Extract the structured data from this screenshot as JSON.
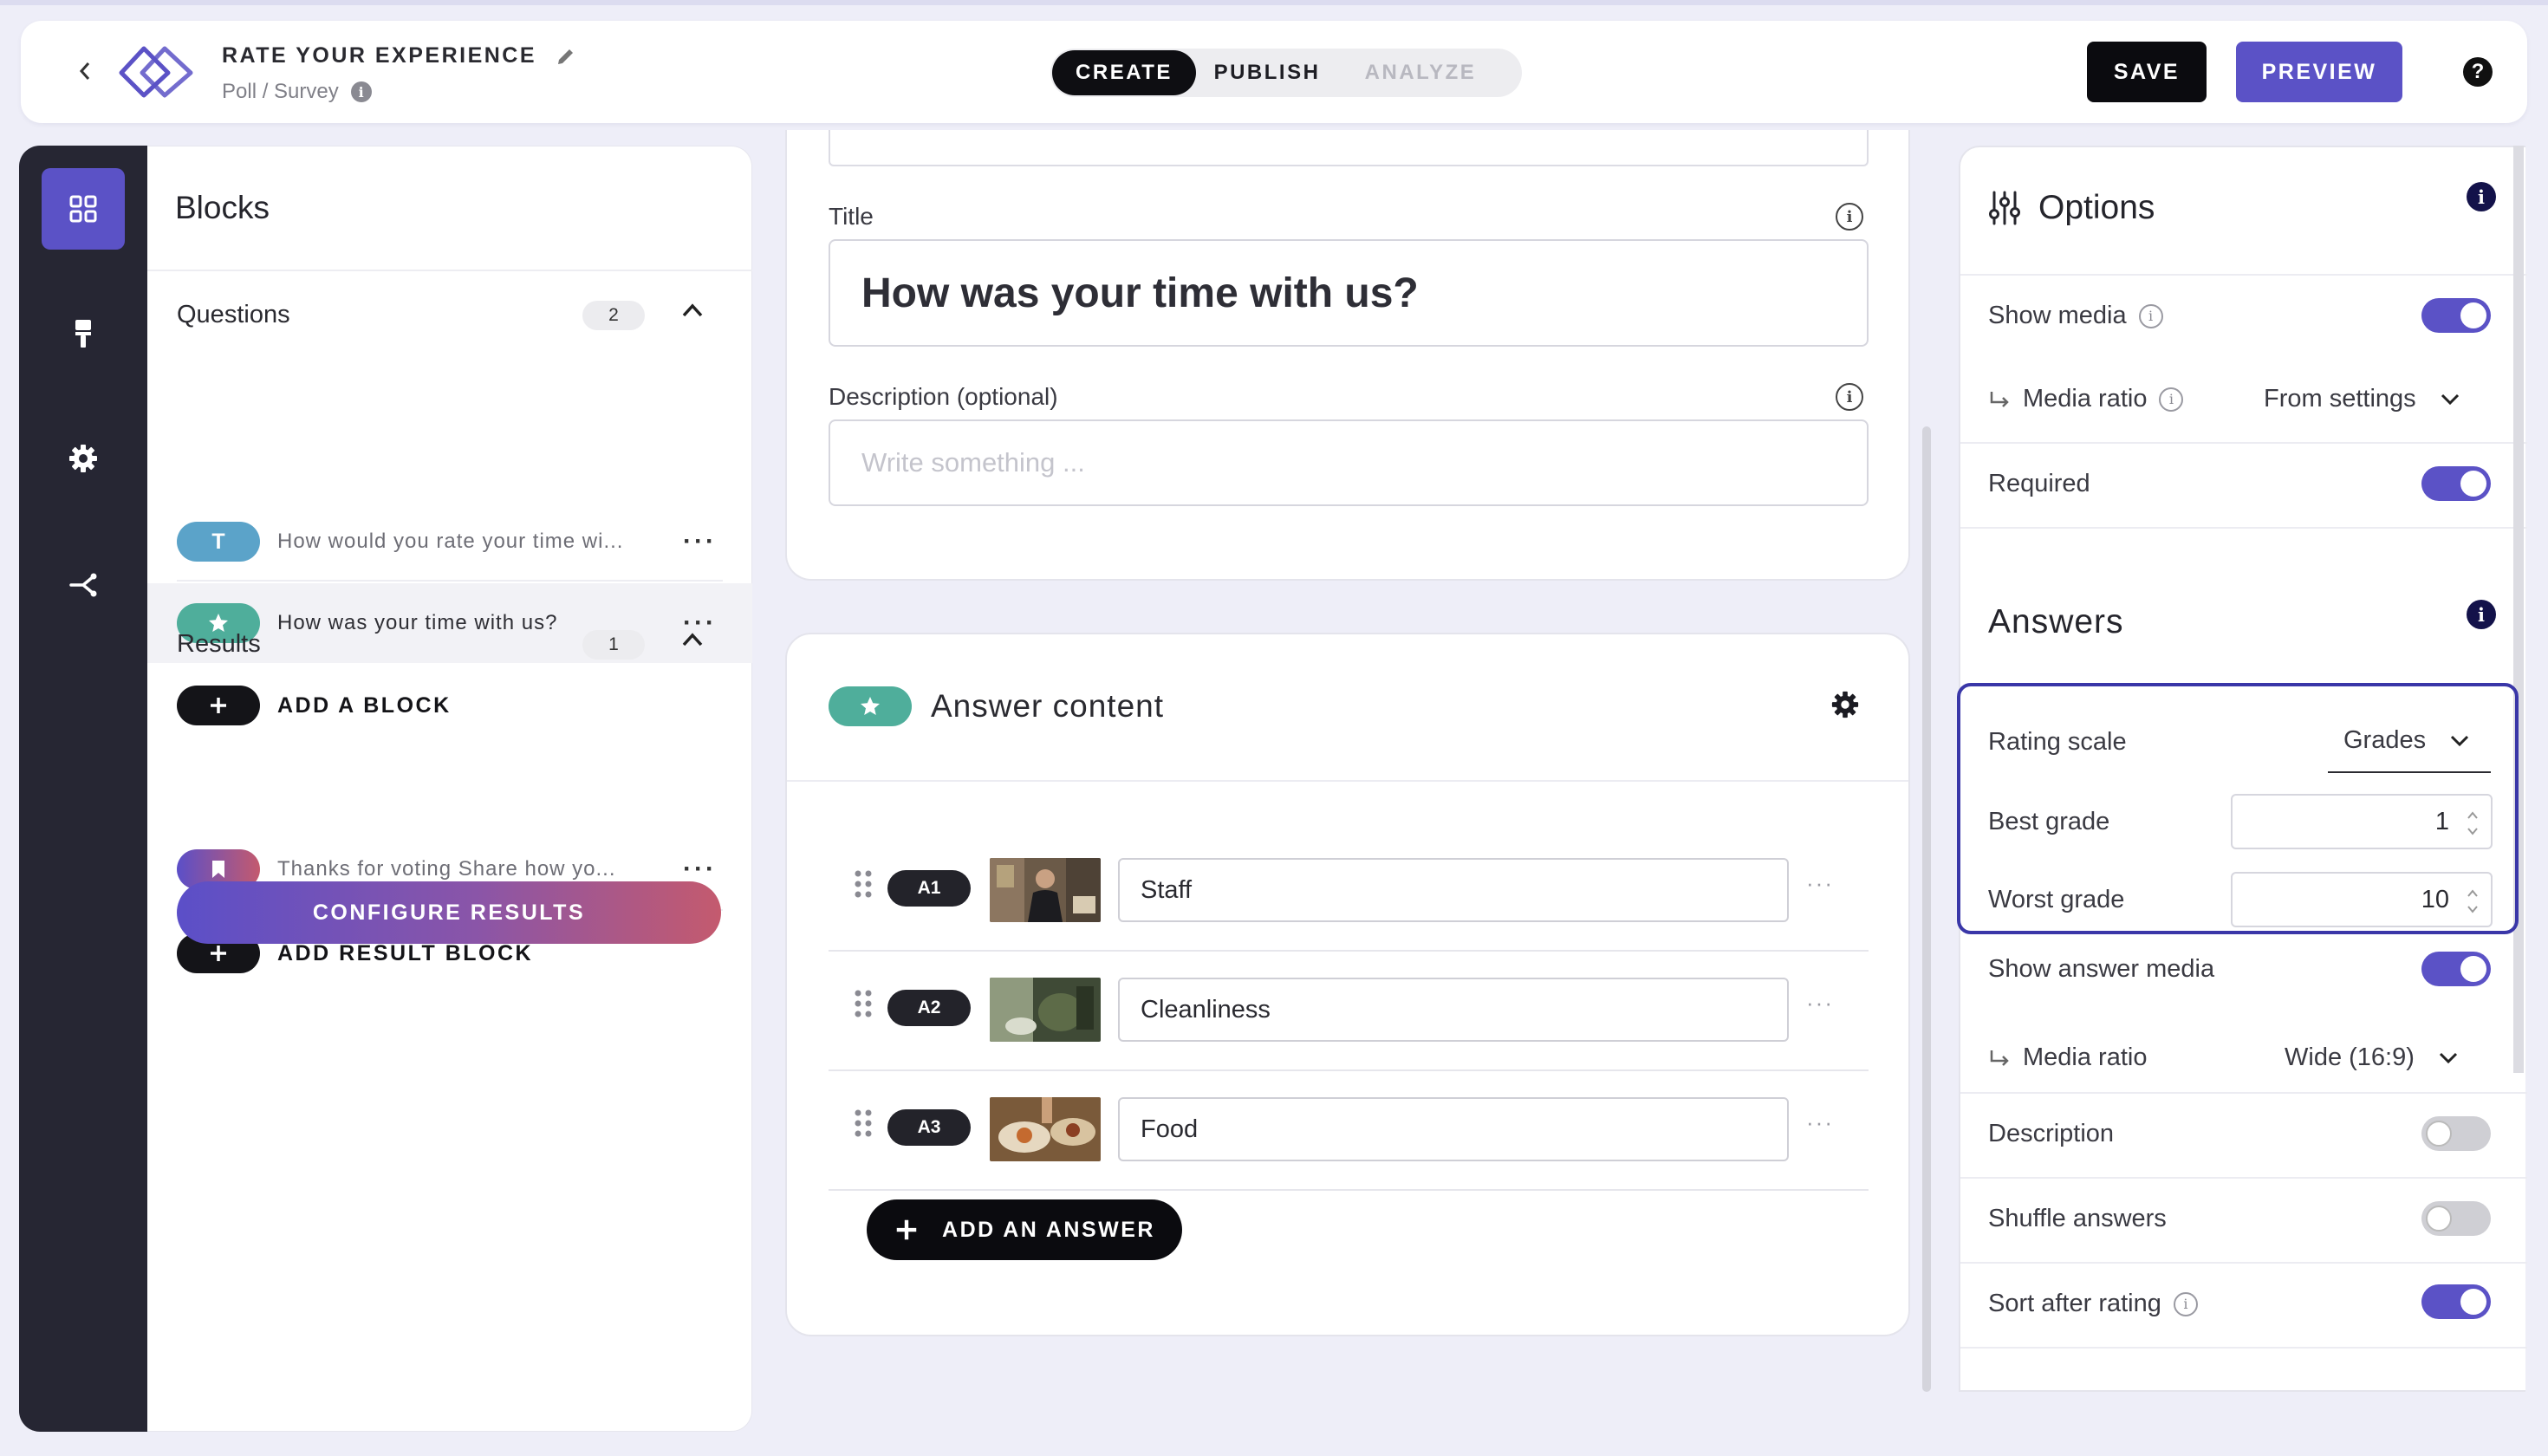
{
  "header": {
    "title": "RATE YOUR EXPERIENCE",
    "subtitle": "Poll / Survey",
    "modes": [
      "CREATE",
      "PUBLISH",
      "ANALYZE"
    ],
    "save_label": "SAVE",
    "preview_label": "PREVIEW",
    "help_label": "?"
  },
  "blocks": {
    "title": "Blocks",
    "questions": {
      "label": "Questions",
      "count": "2",
      "items": [
        {
          "badge": "T",
          "text": "How would you rate your time wi...",
          "color": "#5ba3c9"
        },
        {
          "badge": "star-icon",
          "text": "How was your time with us?",
          "color": "#4fae9b"
        }
      ],
      "add_label": "ADD A BLOCK"
    },
    "results": {
      "label": "Results",
      "count": "1",
      "items": [
        {
          "badge": "bookmark-icon",
          "text": "Thanks for voting Share how yo..."
        }
      ],
      "add_label": "ADD RESULT BLOCK"
    },
    "configure_label": "CONFIGURE RESULTS"
  },
  "editor": {
    "title_label": "Title",
    "title_value": "How was your time with us?",
    "description_label": "Description (optional)",
    "description_placeholder": "Write something ..."
  },
  "answer_content": {
    "title": "Answer content",
    "answers": [
      {
        "id": "A1",
        "value": "Staff"
      },
      {
        "id": "A2",
        "value": "Cleanliness"
      },
      {
        "id": "A3",
        "value": "Food"
      }
    ],
    "add_label": "ADD AN ANSWER"
  },
  "options": {
    "title": "Options",
    "show_media": {
      "label": "Show media",
      "on": true
    },
    "media_ratio": {
      "label": "Media ratio",
      "value": "From settings"
    },
    "required": {
      "label": "Required",
      "on": true
    },
    "answers_title": "Answers",
    "rating_scale": {
      "label": "Rating scale",
      "value": "Grades"
    },
    "best_grade": {
      "label": "Best grade",
      "value": "1"
    },
    "worst_grade": {
      "label": "Worst grade",
      "value": "10"
    },
    "show_answer_media": {
      "label": "Show answer media",
      "on": true
    },
    "answer_media_ratio": {
      "label": "Media ratio",
      "value": "Wide (16:9)"
    },
    "description": {
      "label": "Description",
      "on": false
    },
    "shuffle_answers": {
      "label": "Shuffle answers",
      "on": false
    },
    "sort_after_rating": {
      "label": "Sort after rating",
      "on": true
    }
  },
  "colors": {
    "accent": "#5b52c6",
    "teal_badge": "#4fae9b",
    "blue_badge": "#5ba3c9",
    "dark": "#0b0b0f"
  }
}
